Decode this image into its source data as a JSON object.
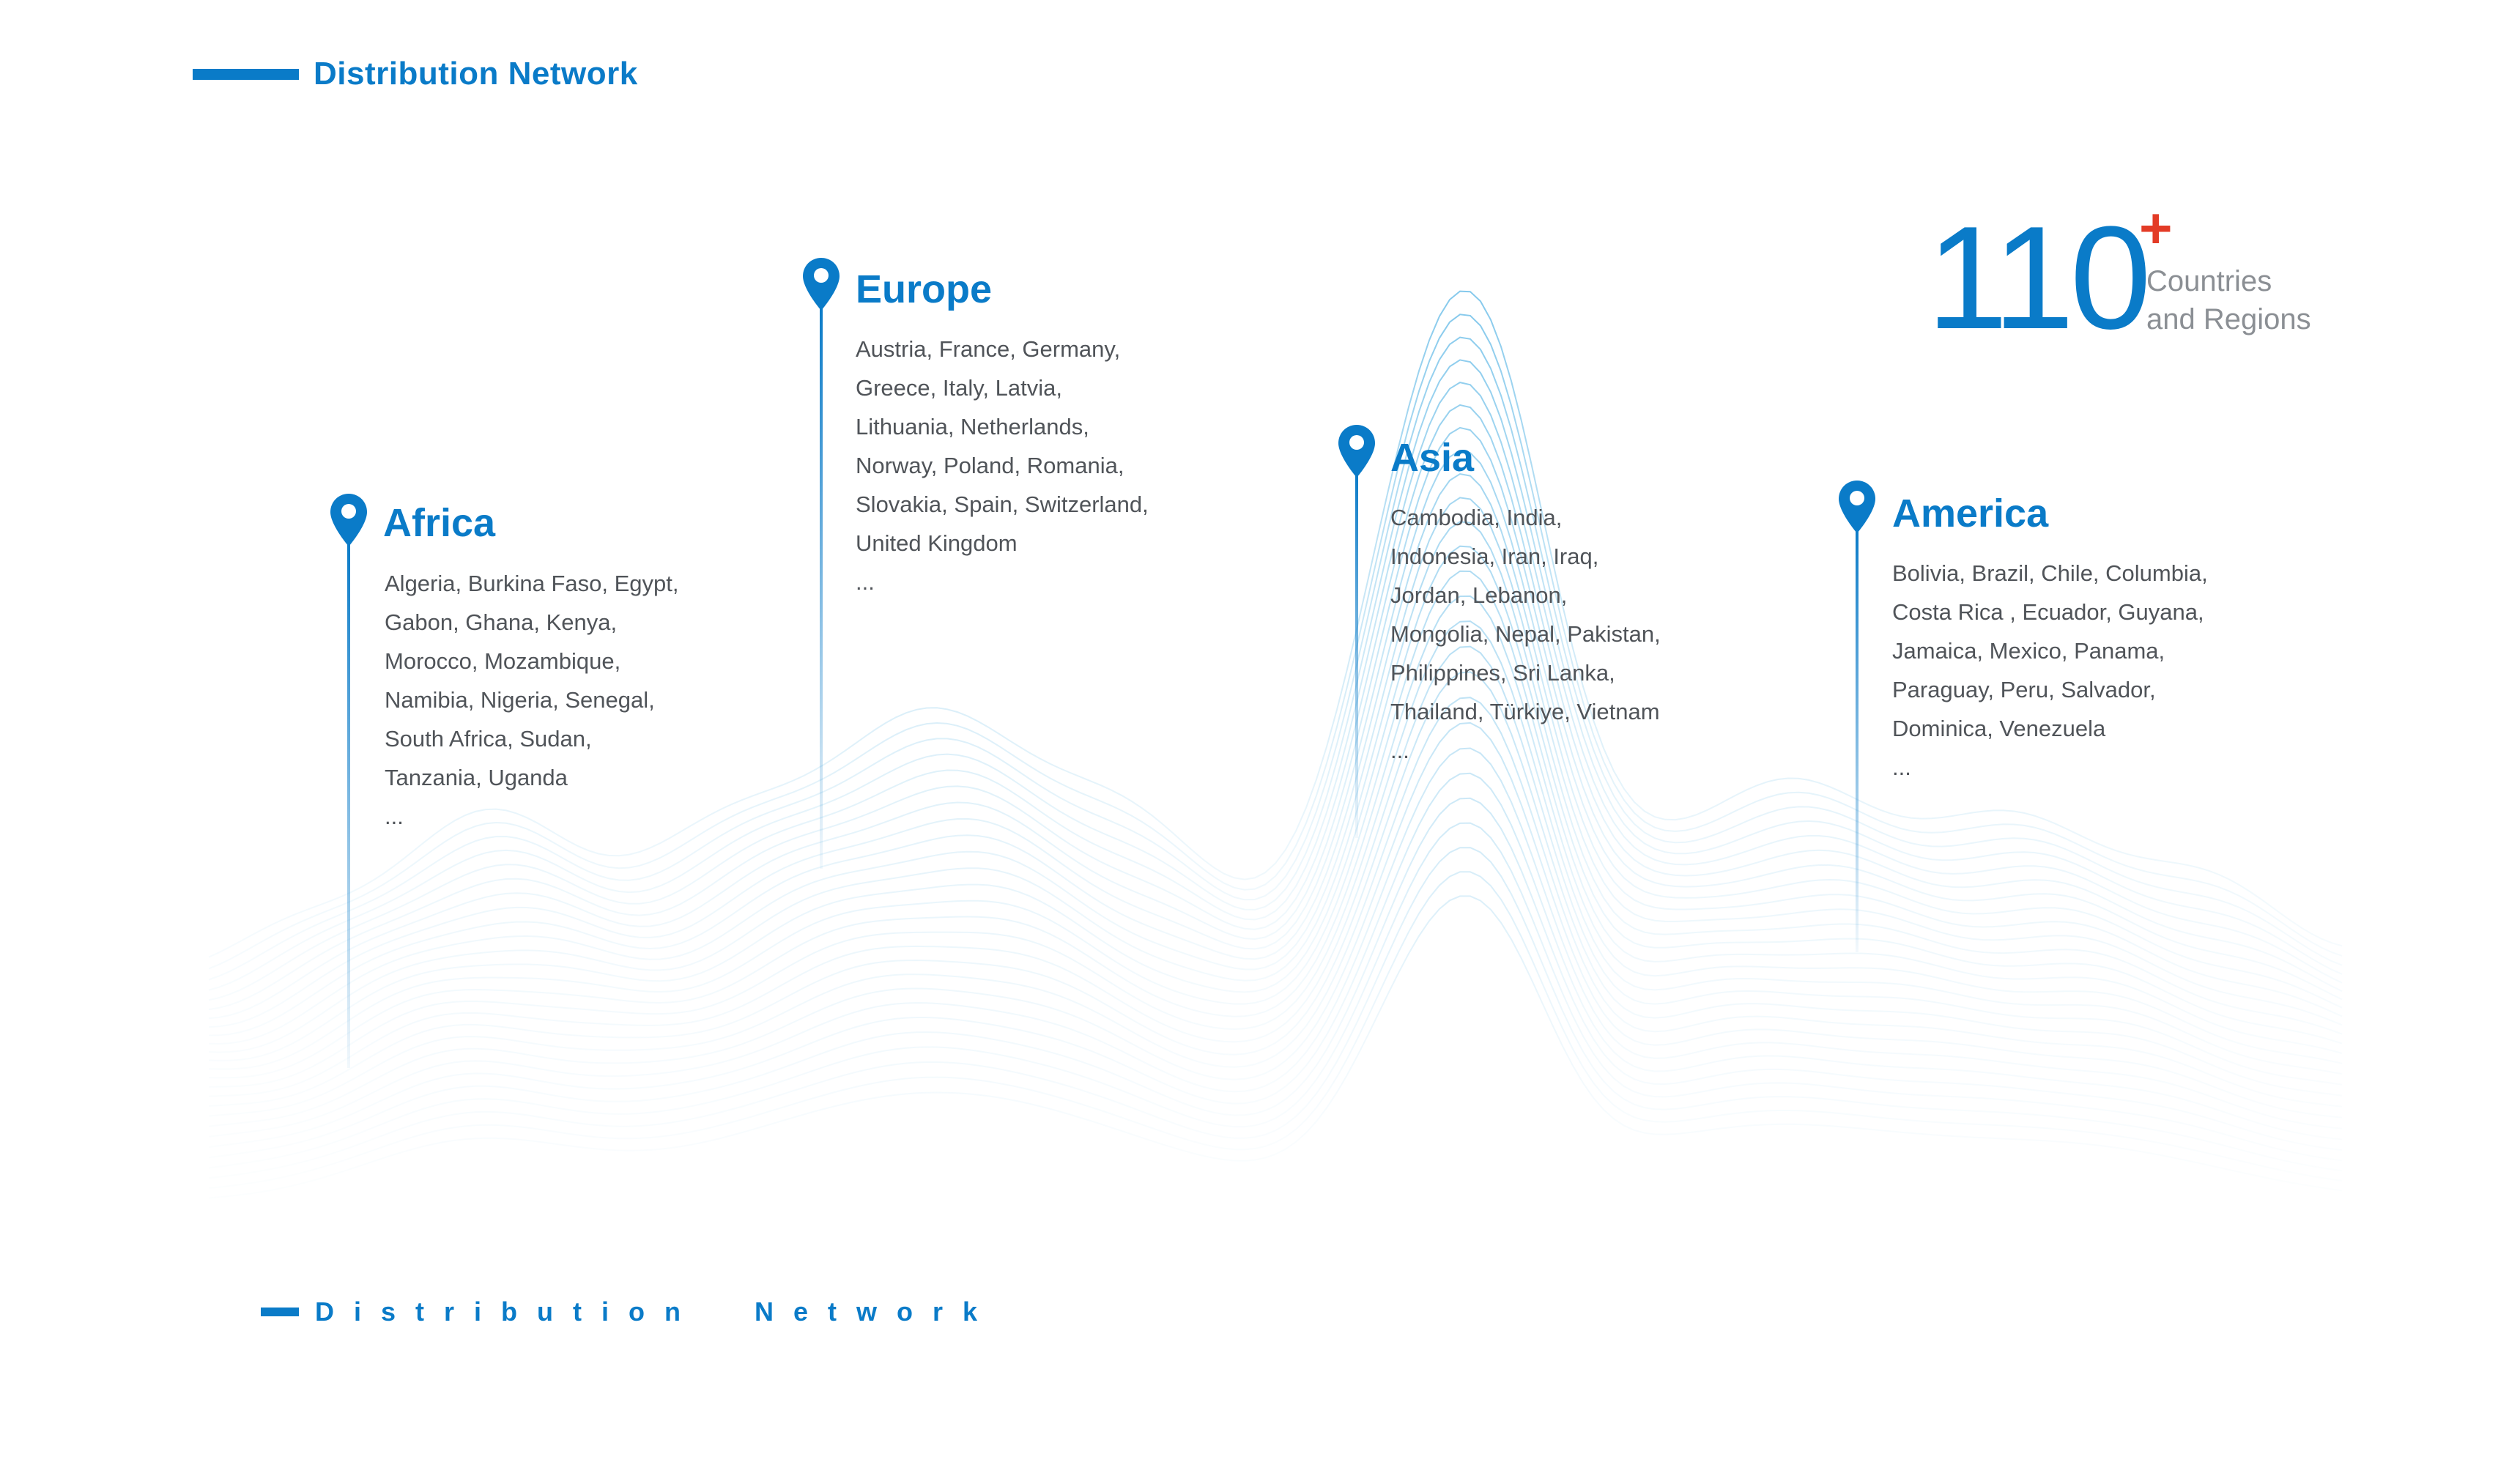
{
  "header": {
    "title": "Distribution Network"
  },
  "stat": {
    "number": "110",
    "plus": "+",
    "label_line1": "Countries",
    "label_line2": "and Regions"
  },
  "regions": {
    "africa": {
      "title": "Africa",
      "lines": [
        "Algeria, Burkina Faso, Egypt,",
        "Gabon, Ghana, Kenya,",
        "Morocco, Mozambique,",
        "Namibia, Nigeria, Senegal,",
        "South Africa, Sudan,",
        "Tanzania, Uganda",
        "..."
      ]
    },
    "europe": {
      "title": "Europe",
      "lines": [
        "Austria, France, Germany,",
        "Greece, Italy, Latvia,",
        "Lithuania, Netherlands,",
        "Norway, Poland, Romania,",
        "Slovakia, Spain, Switzerland,",
        "United Kingdom",
        "..."
      ]
    },
    "asia": {
      "title": "Asia",
      "lines": [
        "Cambodia, India,",
        "Indonesia, Iran, Iraq,",
        "Jordan, Lebanon,",
        "Mongolia, Nepal, Pakistan,",
        "Philippines, Sri Lanka,",
        "Thailand, Türkiye, Vietnam",
        "..."
      ]
    },
    "america": {
      "title": "America",
      "lines": [
        "Bolivia, Brazil, Chile, Columbia,",
        "Costa Rica , Ecuador, Guyana,",
        "Jamaica, Mexico, Panama,",
        "Paraguay, Peru, Salvador,",
        "Dominica, Venezuela",
        "..."
      ]
    }
  },
  "footer": {
    "title": "Distribution  Network"
  },
  "colors": {
    "accent": "#0a7bc8",
    "plus": "#e33b26",
    "text": "#505459",
    "muted": "#8b8f94"
  },
  "icons": {
    "region_marker": "map-pin-icon"
  }
}
